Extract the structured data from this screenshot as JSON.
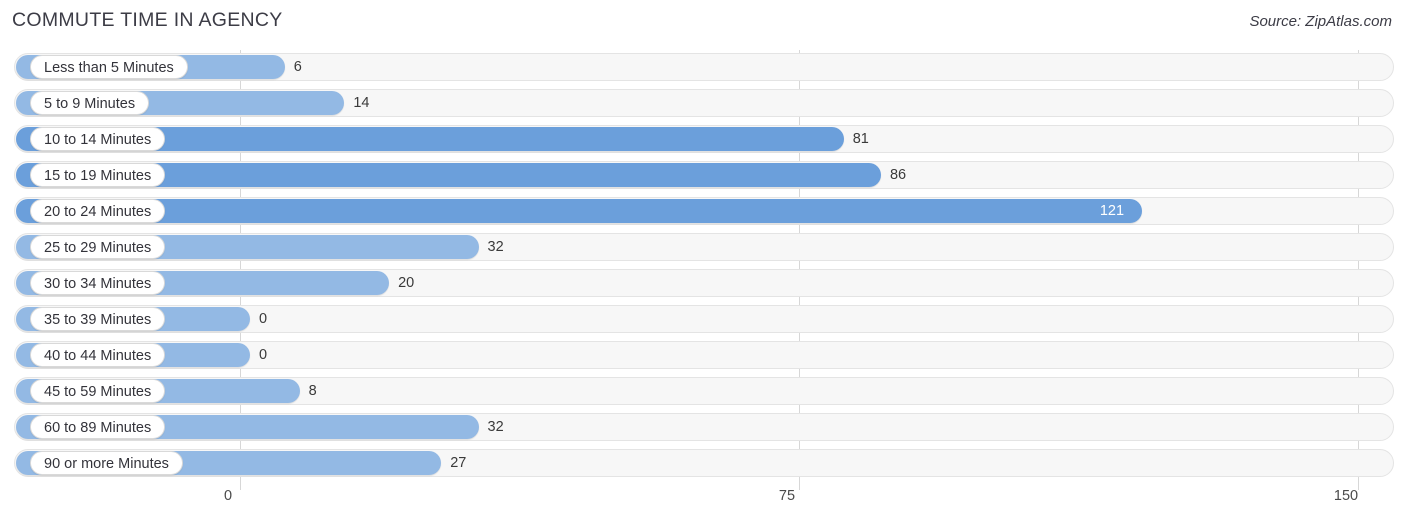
{
  "header": {
    "title": "COMMUTE TIME IN AGENCY",
    "source": "Source: ZipAtlas.com"
  },
  "colors": {
    "bar_light": "#93b9e4",
    "bar_dark": "#6b9fdb",
    "track": "#f7f7f7",
    "track_border": "#e4e4e4",
    "gridline": "#d7d7d7",
    "text": "#3a3a3a",
    "value_inside": "#ffffff"
  },
  "axis": {
    "ticks": [
      "0",
      "75",
      "150"
    ],
    "min": 0,
    "max": 150
  },
  "chart_data": {
    "type": "bar",
    "orientation": "horizontal",
    "title": "COMMUTE TIME IN AGENCY",
    "subtitle": "",
    "source": "Source: ZipAtlas.com",
    "xlabel": "",
    "ylabel": "",
    "xlim": [
      0,
      150
    ],
    "xticks": [
      0,
      75,
      150
    ],
    "grid": true,
    "legend": false,
    "categories": [
      "Less than 5 Minutes",
      "5 to 9 Minutes",
      "10 to 14 Minutes",
      "15 to 19 Minutes",
      "20 to 24 Minutes",
      "25 to 29 Minutes",
      "30 to 34 Minutes",
      "35 to 39 Minutes",
      "40 to 44 Minutes",
      "45 to 59 Minutes",
      "60 to 89 Minutes",
      "90 or more Minutes"
    ],
    "values": [
      6,
      14,
      81,
      86,
      121,
      32,
      20,
      0,
      0,
      8,
      32,
      27
    ],
    "labels": [
      "6",
      "14",
      "81",
      "86",
      "121",
      "32",
      "20",
      "0",
      "0",
      "8",
      "32",
      "27"
    ]
  },
  "rows": [
    {
      "label": "Less than 5 Minutes",
      "value": 6,
      "display": "6",
      "shade": "light",
      "label_inside": false
    },
    {
      "label": "5 to 9 Minutes",
      "value": 14,
      "display": "14",
      "shade": "light",
      "label_inside": false
    },
    {
      "label": "10 to 14 Minutes",
      "value": 81,
      "display": "81",
      "shade": "dark",
      "label_inside": false
    },
    {
      "label": "15 to 19 Minutes",
      "value": 86,
      "display": "86",
      "shade": "dark",
      "label_inside": false
    },
    {
      "label": "20 to 24 Minutes",
      "value": 121,
      "display": "121",
      "shade": "dark",
      "label_inside": true
    },
    {
      "label": "25 to 29 Minutes",
      "value": 32,
      "display": "32",
      "shade": "light",
      "label_inside": false
    },
    {
      "label": "30 to 34 Minutes",
      "value": 20,
      "display": "20",
      "shade": "light",
      "label_inside": false
    },
    {
      "label": "35 to 39 Minutes",
      "value": 0,
      "display": "0",
      "shade": "light",
      "label_inside": false
    },
    {
      "label": "40 to 44 Minutes",
      "value": 0,
      "display": "0",
      "shade": "light",
      "label_inside": false
    },
    {
      "label": "45 to 59 Minutes",
      "value": 8,
      "display": "8",
      "shade": "light",
      "label_inside": false
    },
    {
      "label": "60 to 89 Minutes",
      "value": 32,
      "display": "32",
      "shade": "light",
      "label_inside": false
    },
    {
      "label": "90 or more Minutes",
      "value": 27,
      "display": "27",
      "shade": "light",
      "label_inside": false
    }
  ]
}
